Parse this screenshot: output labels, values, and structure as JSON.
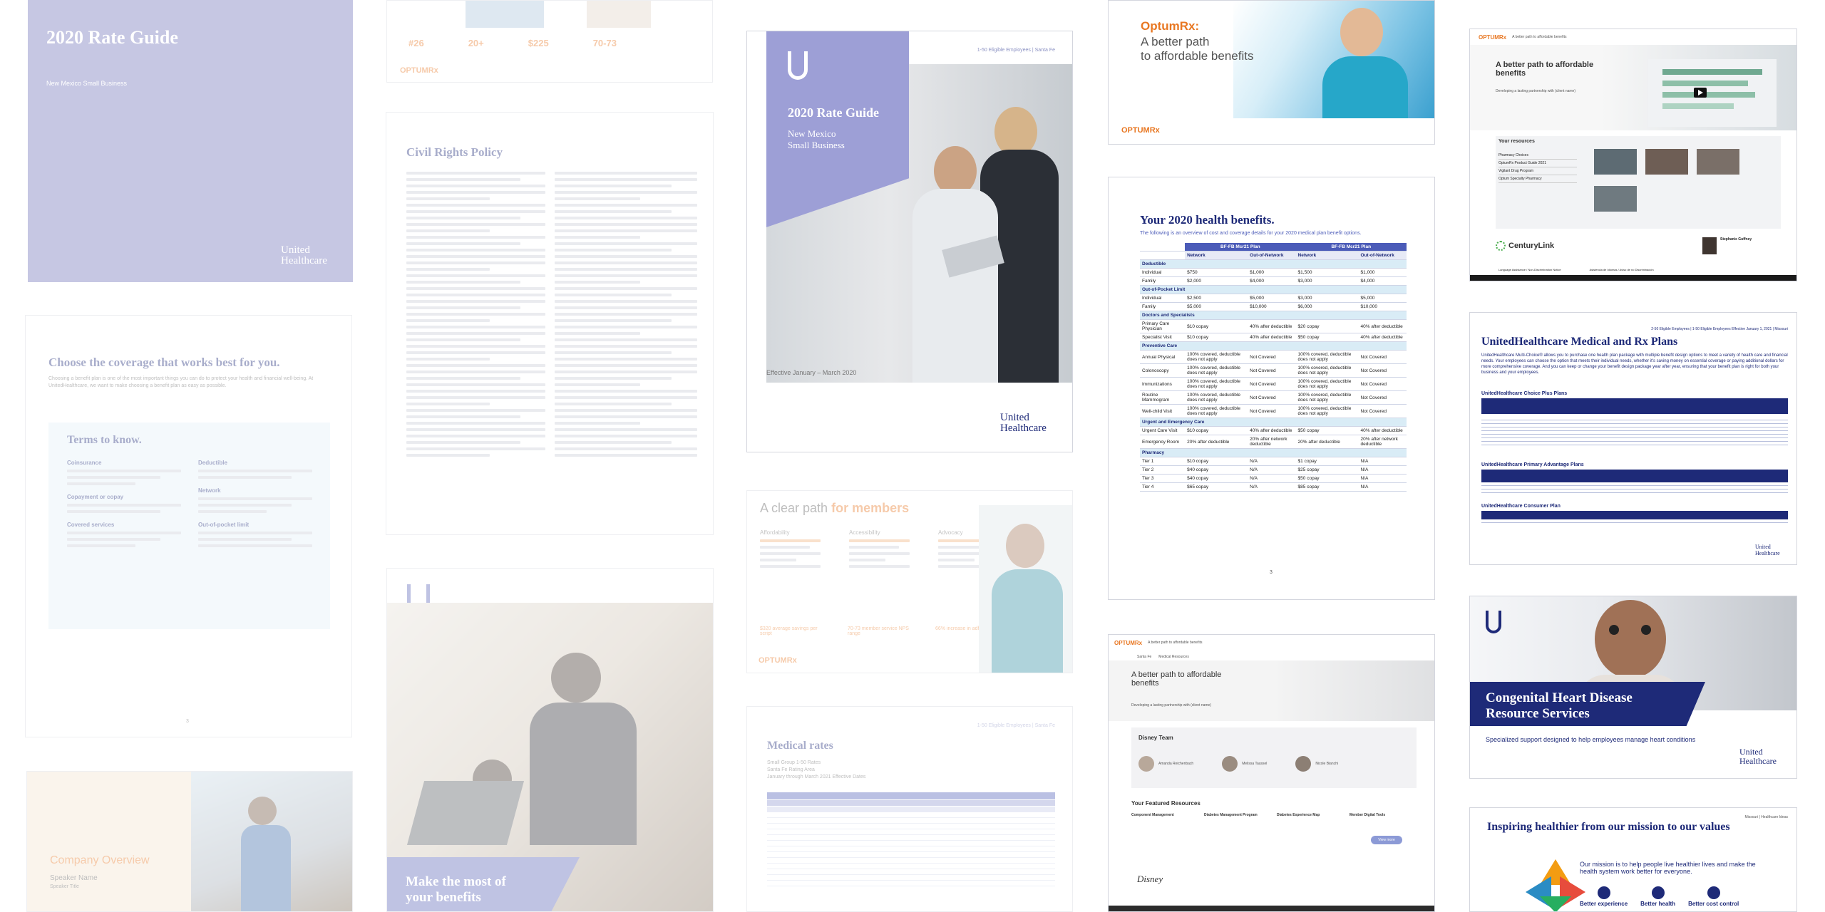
{
  "card1": {
    "title": "2020 Rate Guide",
    "subtitle": "New Mexico Small Business",
    "logo_line1": "United",
    "logo_line2": "Healthcare"
  },
  "card2": {
    "title": "Choose the coverage that works best for you.",
    "intro": "Choosing a benefit plan is one of the most important things you can do to protect your health and financial well-being. At UnitedHealthcare, we want to make choosing a benefit plan as easy as possible.",
    "terms_title": "Terms to know.",
    "terms": [
      "Coinsurance",
      "Deductible",
      "Copayment or copay",
      "Network",
      "Covered services",
      "Out-of-pocket limit"
    ],
    "page_no": "3"
  },
  "card3": {
    "title": "Company Overview",
    "speaker": "Speaker Name",
    "speaker_title": "Speaker Title"
  },
  "card4": {
    "stats": [
      "#26",
      "20+",
      "$225",
      "70-73"
    ],
    "optum": "OPTUMRx"
  },
  "card5": {
    "title": "Civil Rights Policy"
  },
  "card6": {
    "heading_line1": "Make the most of",
    "heading_line2": "your benefits"
  },
  "card7": {
    "header_right": "1-50 Eligible Employees  |  Santa Fe",
    "title": "2020 Rate Guide",
    "subtitle_line1": "New Mexico",
    "subtitle_line2": "Small Business",
    "effective": "Effective January – March 2020",
    "logo_line1": "United",
    "logo_line2": "Healthcare"
  },
  "card8": {
    "title_a": "A clear path",
    "title_b": "for members",
    "cols": [
      "Affordability",
      "Accessibility",
      "Advocacy"
    ],
    "stats": [
      "$320 average savings per script",
      "70-73 member service NPS range",
      "66% increase in adherence"
    ],
    "optum": "OPTUMRx"
  },
  "card9": {
    "header_right": "1-50 Eligible Employees  |  Santa Fe",
    "title": "Medical rates",
    "meta": [
      "Small Group 1-50 Rates",
      "Santa Fe Rating Area",
      "January through March 2021 Effective Dates"
    ]
  },
  "card10": {
    "brand": "OptumRx:",
    "line1": "A better path",
    "line2": "to affordable benefits",
    "optum": "OPTUMRx"
  },
  "card11": {
    "title": "Your 2020 health benefits.",
    "intro": "The following is an overview of cost and coverage details for your 2020 medical plan benefit options.",
    "plan_a": "BF-FB Mcr21 Plan",
    "plan_b": "BF-FB Mcr21 Plan",
    "col_net": "Network",
    "col_oon": "Out-of-Network",
    "rows": [
      {
        "sec": true,
        "label": "Deductible"
      },
      {
        "label": "Individual",
        "v": [
          "$750",
          "$1,000",
          "$1,500",
          "$1,000"
        ]
      },
      {
        "label": "Family",
        "v": [
          "$2,000",
          "$4,000",
          "$3,000",
          "$4,000"
        ]
      },
      {
        "sec": true,
        "label": "Out-of-Pocket Limit"
      },
      {
        "label": "Individual",
        "v": [
          "$2,500",
          "$5,000",
          "$3,000",
          "$5,000"
        ]
      },
      {
        "label": "Family",
        "v": [
          "$5,000",
          "$10,000",
          "$6,000",
          "$10,000"
        ]
      },
      {
        "sec": true,
        "label": "Doctors and Specialists"
      },
      {
        "label": "Primary Care Physician",
        "v": [
          "$10 copay",
          "40% after deductible",
          "$20 copay",
          "40% after deductible"
        ]
      },
      {
        "label": "Specialist Visit",
        "v": [
          "$10 copay",
          "40% after deductible",
          "$50 copay",
          "40% after deductible"
        ]
      },
      {
        "sec": true,
        "label": "Preventive Care"
      },
      {
        "label": "Annual Physical",
        "v": [
          "100% covered, deductible does not apply",
          "Not Covered",
          "100% covered, deductible does not apply",
          "Not Covered"
        ]
      },
      {
        "label": "Colonoscopy",
        "v": [
          "100% covered, deductible does not apply",
          "Not Covered",
          "100% covered, deductible does not apply",
          "Not Covered"
        ]
      },
      {
        "label": "Immunizations",
        "v": [
          "100% covered, deductible does not apply",
          "Not Covered",
          "100% covered, deductible does not apply",
          "Not Covered"
        ]
      },
      {
        "label": "Routine Mammogram",
        "v": [
          "100% covered, deductible does not apply",
          "Not Covered",
          "100% covered, deductible does not apply",
          "Not Covered"
        ]
      },
      {
        "label": "Well-child Visit",
        "v": [
          "100% covered, deductible does not apply",
          "Not Covered",
          "100% covered, deductible does not apply",
          "Not Covered"
        ]
      },
      {
        "sec": true,
        "label": "Urgent and Emergency Care"
      },
      {
        "label": "Urgent Care Visit",
        "v": [
          "$10 copay",
          "40% after deductible",
          "$50 copay",
          "40% after deductible"
        ]
      },
      {
        "label": "Emergency Room",
        "v": [
          "20% after deductible",
          "20% after network deductible",
          "20% after deductible",
          "20% after network deductible"
        ]
      },
      {
        "sec": true,
        "label": "Pharmacy"
      },
      {
        "label": "Tier 1",
        "v": [
          "$10 copay",
          "N/A",
          "$1 copay",
          "N/A"
        ]
      },
      {
        "label": "Tier 2",
        "v": [
          "$40 copay",
          "N/A",
          "$25 copay",
          "N/A"
        ]
      },
      {
        "label": "Tier 3",
        "v": [
          "$40 copay",
          "N/A",
          "$50 copay",
          "N/A"
        ]
      },
      {
        "label": "Tier 4",
        "v": [
          "$65 copay",
          "N/A",
          "$85 copay",
          "N/A"
        ]
      }
    ],
    "page_no": "3"
  },
  "card12": {
    "optum": "OPTUMRx",
    "tagline": "A better path to affordable benefits",
    "crumb1": "Santa Fe",
    "crumb2": "Medical Resources",
    "title_line1": "A better path to affordable",
    "title_line2": "benefits",
    "sub": "Developing a lasting partnership with (client name)",
    "team_title": "Disney Team",
    "team": [
      "Amanda Reichenbach",
      "Melissa Taussel",
      "Nicole Bianchi"
    ],
    "resources_title": "Your Featured Resources",
    "resources": [
      "Component Management",
      "Diabetes Management Program",
      "Diabetes Experience Map",
      "Member Digital Tools"
    ],
    "view_more": "View more",
    "disney": "Disney"
  },
  "card13": {
    "optum": "OPTUMRx",
    "tagline": "A better path to affordable benefits",
    "title_line1": "A better path to affordable",
    "title_line2": "benefits",
    "sub": "Developing a lasting partnership with (client name)",
    "resources_title": "Your resources",
    "resources": [
      "Pharmacy Choices",
      "OptumRx Product Guide 2021",
      "Vigilant Drug Program",
      "Optum Specialty Pharmacy"
    ],
    "centurylink": "CenturyLink",
    "contact_name": "Stephanie Guffney",
    "footer": [
      "Language Assistance / Non-Discrimination Notice",
      "Asistencia de Idiomas / Aviso de no Discriminación"
    ]
  },
  "card14": {
    "header_right": "2-50 Eligible Employees  |  1-50 Eligible Employees Effective January 1, 2021  |  Missouri",
    "title": "UnitedHealthcare Medical and Rx Plans",
    "intro": "UnitedHealthcare Multi-Choice® allows you to purchase one health plan package with multiple benefit design options to meet a variety of health care and financial needs. Your employees can choose the option that meets their individual needs, whether it's saving money on essential coverage or paying additional dollars for more comprehensive coverage. And you can keep or change your benefit design package year after year, ensuring that your benefit plan is right for both your business and your employees.",
    "sections": [
      "UnitedHealthcare Choice Plus Plans",
      "UnitedHealthcare Primary Advantage Plans",
      "UnitedHealthcare Consumer Plan"
    ],
    "logo_line1": "United",
    "logo_line2": "Healthcare"
  },
  "card15": {
    "title_line1": "Congenital Heart Disease",
    "title_line2": "Resource Services",
    "sub": "Specialized support designed to help employees manage heart conditions",
    "logo_line1": "United",
    "logo_line2": "Healthcare"
  },
  "card16": {
    "header_right": "Missouri  |  Healthcare Ideas",
    "title": "Inspiring healthier from our mission to our values",
    "mission": "Our mission is to help people live healthier lives and make the health system work better for everyone.",
    "pillars": [
      "Better experience",
      "Better health",
      "Better cost control"
    ]
  }
}
